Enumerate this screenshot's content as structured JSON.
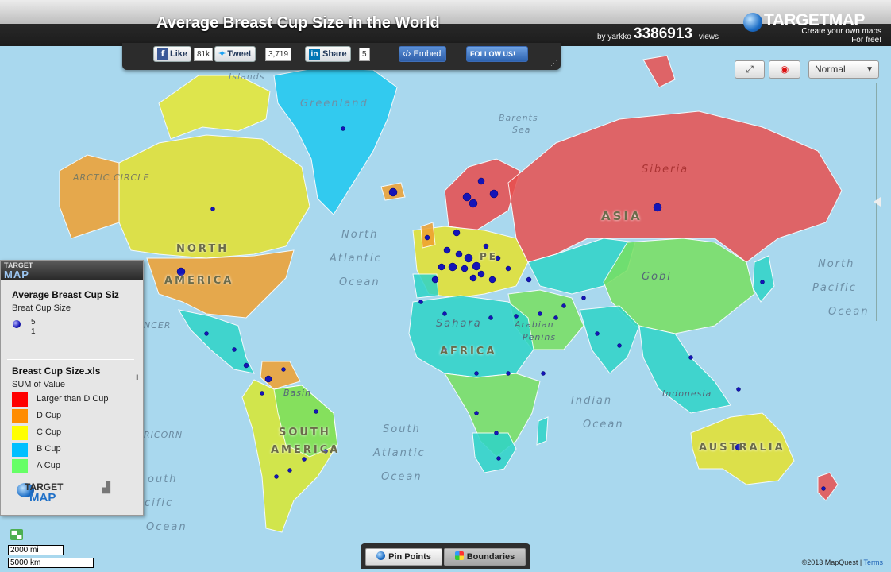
{
  "header": {
    "title": "Average Breast Cup Size in the World",
    "by": "by yarkko",
    "views_count": "3386913",
    "views_label": "views",
    "logo_name": "TARGETMAP",
    "logo_sub1": "Create your own maps",
    "logo_sub2": "For free!"
  },
  "social": {
    "like_label": "Like",
    "like_count": "81k",
    "tweet_label": "Tweet",
    "tweet_count": "3,719",
    "share_label": "Share",
    "share_count": "5",
    "embed_label": "Embed",
    "follow_label": "FOLLOW US!"
  },
  "controls": {
    "view_select": "Normal"
  },
  "map_labels": {
    "greenland": "Greenland",
    "barents": "Barents",
    "sea": "Sea",
    "siberia": "Siberia",
    "asia": "ASIA",
    "north": "North",
    "atlantic": "Atlantic",
    "ocean": "Ocean",
    "north_america_1": "NORTH",
    "north_america_2": "AMERICA",
    "arctic_circle": "ARCTIC CIRCLE",
    "islands": "Islands",
    "gobi": "Gobi",
    "north_pacific_1": "North",
    "north_pacific_2": "Pacific",
    "north_pacific_3": "Ocean",
    "sahara": "Sahara",
    "arabian": "Arabian",
    "penins": "Penins",
    "africa": "AFRICA",
    "basin": "Basin",
    "south_america_1": "SOUTH",
    "south_america_2": "AMERICA",
    "south_atl_1": "South",
    "south_atl_2": "Atlantic",
    "south_atl_3": "Ocean",
    "indian_1": "Indian",
    "indian_2": "Ocean",
    "indonesia": "Indonesia",
    "australia": "AUSTRALIA",
    "south_pac_1": "outh",
    "south_pac_2": "cific",
    "south_pac_3": "Ocean",
    "tropic_cancer": "NCER",
    "tropic_capricorn": "RICORN",
    "europe": "PE"
  },
  "legend": {
    "logo_line1": "TARGET",
    "logo_line2": "MAP",
    "title": "Average Breast Cup Siz",
    "pin_caption": "Breat Cup Size",
    "pin_max": "5",
    "pin_min": "1",
    "file_title": "Breast Cup Size.xls",
    "file_caption": "SUM of Value",
    "items": [
      {
        "label": "Larger than D Cup",
        "color": "#ff0000"
      },
      {
        "label": "D Cup",
        "color": "#ff8c00"
      },
      {
        "label": "C Cup",
        "color": "#ffff00"
      },
      {
        "label": "B Cup",
        "color": "#00bfff"
      },
      {
        "label": "A Cup",
        "color": "#66ff66"
      }
    ],
    "foot_logo1": "TARGET",
    "foot_logo2": "MAP"
  },
  "scale": {
    "miles": "2000 mi",
    "km": "5000 km"
  },
  "tabs": {
    "pin_points": "Pin Points",
    "boundaries": "Boundaries"
  },
  "footer": {
    "copyright": "©2013 MapQuest |",
    "terms": "Terms"
  }
}
